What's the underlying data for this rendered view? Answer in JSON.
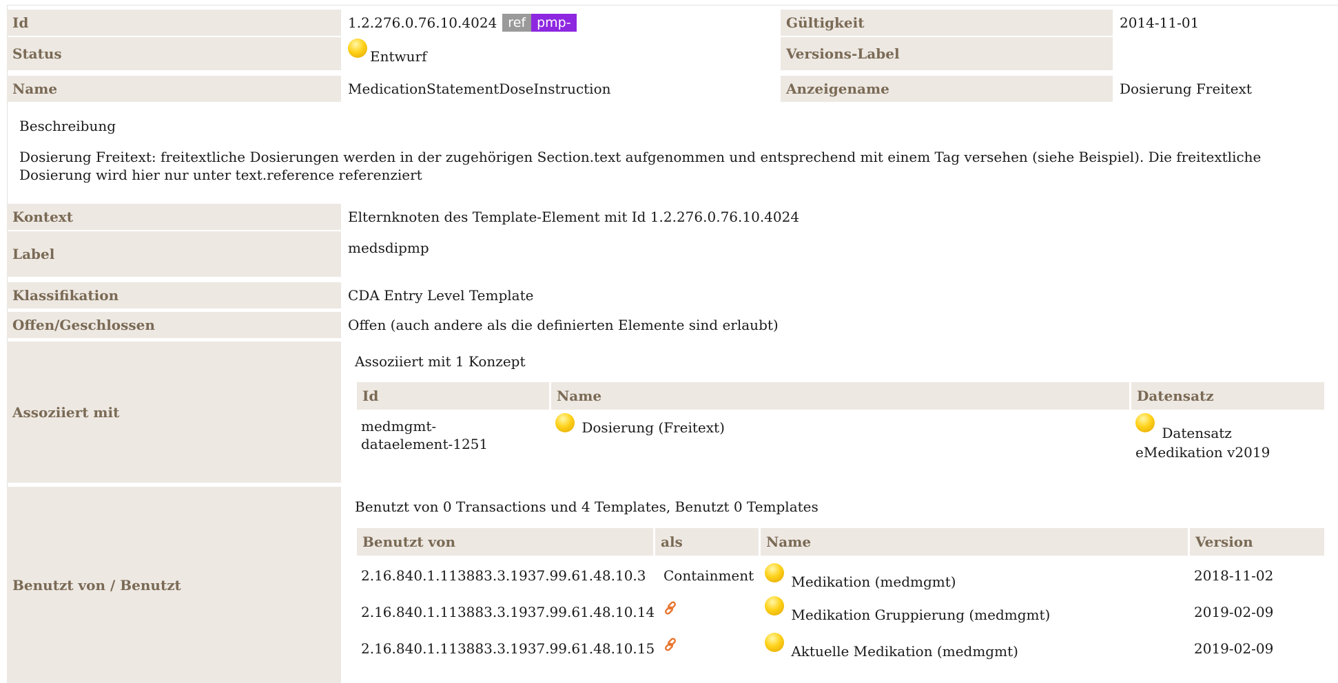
{
  "header": {
    "id_label": "Id",
    "id_value": "1.2.276.0.76.10.4024",
    "ref_badge": "ref",
    "pmp_badge": "pmp-",
    "validity_label": "Gültigkeit",
    "validity_value": "2014-11-01",
    "status_label": "Status",
    "status_value": "Entwurf",
    "version_label_label": "Versions-Label",
    "version_label_value": "",
    "name_label": "Name",
    "name_value": "MedicationStatementDoseInstruction",
    "display_name_label": "Anzeigename",
    "display_name_value": "Dosierung Freitext"
  },
  "description": {
    "heading": "Beschreibung",
    "text_line1": "Dosierung Freitext: freitextliche Dosierungen werden in der zugehörigen Section.text aufgenommen und entsprechend mit einem Tag versehen (siehe Beispiel). Die freitextliche",
    "text_line2": "Dosierung wird hier nur unter text.reference referenziert"
  },
  "details": {
    "context_label": "Kontext",
    "context_value": "Elternknoten des Template-Element mit Id 1.2.276.0.76.10.4024",
    "label_label": "Label",
    "label_value": "medsdipmp",
    "classification_label": "Klassifikation",
    "classification_value": "CDA Entry Level Template",
    "open_closed_label": "Offen/Geschlossen",
    "open_closed_value": "Offen (auch andere als die definierten Elemente sind erlaubt)"
  },
  "associated": {
    "label": "Assoziiert mit",
    "summary": "Assoziiert mit 1 Konzept",
    "headers": {
      "id": "Id",
      "name": "Name",
      "dataset": "Datensatz"
    },
    "row": {
      "id_line1": "medmgmt-",
      "id_line2": "dataelement-1251",
      "name": "Dosierung (Freitext)",
      "dataset_line1": "Datensatz",
      "dataset_line2": "eMedikation v2019"
    }
  },
  "usage": {
    "label": "Benutzt von / Benutzt",
    "summary": "Benutzt von 0 Transactions und 4 Templates, Benutzt 0 Templates",
    "headers": {
      "used_by": "Benutzt von",
      "as": "als",
      "name": "Name",
      "version": "Version"
    },
    "rows": [
      {
        "id": "2.16.840.1.113883.3.1937.99.61.48.10.3",
        "as": "Containment",
        "name": "Medikation (medmgmt)",
        "version": "2018-11-02"
      },
      {
        "id": "2.16.840.1.113883.3.1937.99.61.48.10.14",
        "as": "link-icon",
        "name": "Medikation Gruppierung (medmgmt)",
        "version": "2019-02-09"
      },
      {
        "id": "2.16.840.1.113883.3.1937.99.61.48.10.15",
        "as": "link-icon",
        "name": "Aktuelle Medikation (medmgmt)",
        "version": "2019-02-09"
      }
    ]
  },
  "colors": {
    "label_bg": "#ede8e2",
    "label_text": "#7a6a55",
    "ref_badge": "#9a9a9a",
    "pmp_badge": "#8d28e0",
    "status_draft": "#ffd21a",
    "link_icon": "#e8742c"
  }
}
